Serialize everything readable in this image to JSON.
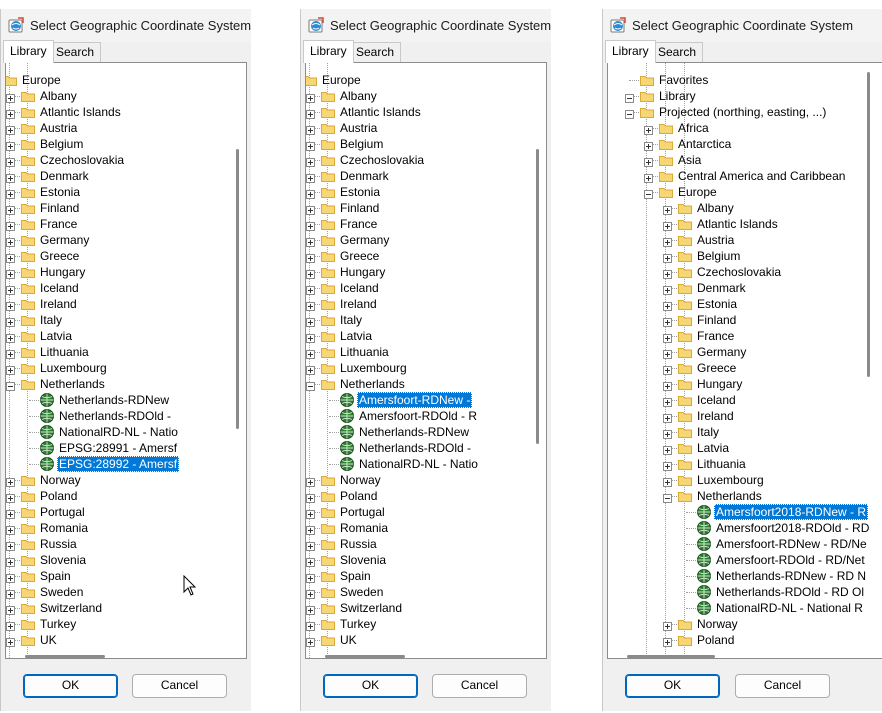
{
  "dialogs": [
    {
      "title": "Select Geographic Coordinate System",
      "tabs": [
        "Library",
        "Search"
      ],
      "ok_label": "OK",
      "cancel_label": "Cancel",
      "tree": [
        {
          "label": "Europe",
          "level": 1,
          "type": "folder",
          "expander": "minus"
        },
        {
          "label": "Albany",
          "level": 2,
          "type": "folder",
          "expander": "plus"
        },
        {
          "label": "Atlantic Islands",
          "level": 2,
          "type": "folder",
          "expander": "plus"
        },
        {
          "label": "Austria",
          "level": 2,
          "type": "folder",
          "expander": "plus"
        },
        {
          "label": "Belgium",
          "level": 2,
          "type": "folder",
          "expander": "plus"
        },
        {
          "label": "Czechoslovakia",
          "level": 2,
          "type": "folder",
          "expander": "plus"
        },
        {
          "label": "Denmark",
          "level": 2,
          "type": "folder",
          "expander": "plus"
        },
        {
          "label": "Estonia",
          "level": 2,
          "type": "folder",
          "expander": "plus"
        },
        {
          "label": "Finland",
          "level": 2,
          "type": "folder",
          "expander": "plus"
        },
        {
          "label": "France",
          "level": 2,
          "type": "folder",
          "expander": "plus"
        },
        {
          "label": "Germany",
          "level": 2,
          "type": "folder",
          "expander": "plus"
        },
        {
          "label": "Greece",
          "level": 2,
          "type": "folder",
          "expander": "plus"
        },
        {
          "label": "Hungary",
          "level": 2,
          "type": "folder",
          "expander": "plus"
        },
        {
          "label": "Iceland",
          "level": 2,
          "type": "folder",
          "expander": "plus"
        },
        {
          "label": "Ireland",
          "level": 2,
          "type": "folder",
          "expander": "plus"
        },
        {
          "label": "Italy",
          "level": 2,
          "type": "folder",
          "expander": "plus"
        },
        {
          "label": "Latvia",
          "level": 2,
          "type": "folder",
          "expander": "plus"
        },
        {
          "label": "Lithuania",
          "level": 2,
          "type": "folder",
          "expander": "plus"
        },
        {
          "label": "Luxembourg",
          "level": 2,
          "type": "folder",
          "expander": "plus"
        },
        {
          "label": "Netherlands",
          "level": 2,
          "type": "folder",
          "expander": "minus"
        },
        {
          "label": "Netherlands-RDNew",
          "level": 3,
          "type": "globe"
        },
        {
          "label": "Netherlands-RDOld -",
          "level": 3,
          "type": "globe"
        },
        {
          "label": "NationalRD-NL - Natio",
          "level": 3,
          "type": "globe"
        },
        {
          "label": "EPSG:28991 - Amersf",
          "level": 3,
          "type": "globe"
        },
        {
          "label": "EPSG:28992 - Amersf",
          "level": 3,
          "type": "globe",
          "selected": true
        },
        {
          "label": "Norway",
          "level": 2,
          "type": "folder",
          "expander": "plus"
        },
        {
          "label": "Poland",
          "level": 2,
          "type": "folder",
          "expander": "plus"
        },
        {
          "label": "Portugal",
          "level": 2,
          "type": "folder",
          "expander": "plus"
        },
        {
          "label": "Romania",
          "level": 2,
          "type": "folder",
          "expander": "plus"
        },
        {
          "label": "Russia",
          "level": 2,
          "type": "folder",
          "expander": "plus"
        },
        {
          "label": "Slovenia",
          "level": 2,
          "type": "folder",
          "expander": "plus"
        },
        {
          "label": "Spain",
          "level": 2,
          "type": "folder",
          "expander": "plus"
        },
        {
          "label": "Sweden",
          "level": 2,
          "type": "folder",
          "expander": "plus"
        },
        {
          "label": "Switzerland",
          "level": 2,
          "type": "folder",
          "expander": "plus"
        },
        {
          "label": "Turkey",
          "level": 2,
          "type": "folder",
          "expander": "plus"
        },
        {
          "label": "UK",
          "level": 2,
          "type": "folder",
          "expander": "plus"
        }
      ]
    },
    {
      "title": "Select Geographic Coordinate System",
      "tabs": [
        "Library",
        "Search"
      ],
      "ok_label": "OK",
      "cancel_label": "Cancel",
      "tree": [
        {
          "label": "Europe",
          "level": 1,
          "type": "folder",
          "expander": "minus"
        },
        {
          "label": "Albany",
          "level": 2,
          "type": "folder",
          "expander": "plus"
        },
        {
          "label": "Atlantic Islands",
          "level": 2,
          "type": "folder",
          "expander": "plus"
        },
        {
          "label": "Austria",
          "level": 2,
          "type": "folder",
          "expander": "plus"
        },
        {
          "label": "Belgium",
          "level": 2,
          "type": "folder",
          "expander": "plus"
        },
        {
          "label": "Czechoslovakia",
          "level": 2,
          "type": "folder",
          "expander": "plus"
        },
        {
          "label": "Denmark",
          "level": 2,
          "type": "folder",
          "expander": "plus"
        },
        {
          "label": "Estonia",
          "level": 2,
          "type": "folder",
          "expander": "plus"
        },
        {
          "label": "Finland",
          "level": 2,
          "type": "folder",
          "expander": "plus"
        },
        {
          "label": "France",
          "level": 2,
          "type": "folder",
          "expander": "plus"
        },
        {
          "label": "Germany",
          "level": 2,
          "type": "folder",
          "expander": "plus"
        },
        {
          "label": "Greece",
          "level": 2,
          "type": "folder",
          "expander": "plus"
        },
        {
          "label": "Hungary",
          "level": 2,
          "type": "folder",
          "expander": "plus"
        },
        {
          "label": "Iceland",
          "level": 2,
          "type": "folder",
          "expander": "plus"
        },
        {
          "label": "Ireland",
          "level": 2,
          "type": "folder",
          "expander": "plus"
        },
        {
          "label": "Italy",
          "level": 2,
          "type": "folder",
          "expander": "plus"
        },
        {
          "label": "Latvia",
          "level": 2,
          "type": "folder",
          "expander": "plus"
        },
        {
          "label": "Lithuania",
          "level": 2,
          "type": "folder",
          "expander": "plus"
        },
        {
          "label": "Luxembourg",
          "level": 2,
          "type": "folder",
          "expander": "plus"
        },
        {
          "label": "Netherlands",
          "level": 2,
          "type": "folder",
          "expander": "minus"
        },
        {
          "label": "Amersfoort-RDNew -",
          "level": 3,
          "type": "globe",
          "selected": true
        },
        {
          "label": "Amersfoort-RDOld - R",
          "level": 3,
          "type": "globe"
        },
        {
          "label": "Netherlands-RDNew",
          "level": 3,
          "type": "globe"
        },
        {
          "label": "Netherlands-RDOld -",
          "level": 3,
          "type": "globe"
        },
        {
          "label": "NationalRD-NL - Natio",
          "level": 3,
          "type": "globe"
        },
        {
          "label": "Norway",
          "level": 2,
          "type": "folder",
          "expander": "plus"
        },
        {
          "label": "Poland",
          "level": 2,
          "type": "folder",
          "expander": "plus"
        },
        {
          "label": "Portugal",
          "level": 2,
          "type": "folder",
          "expander": "plus"
        },
        {
          "label": "Romania",
          "level": 2,
          "type": "folder",
          "expander": "plus"
        },
        {
          "label": "Russia",
          "level": 2,
          "type": "folder",
          "expander": "plus"
        },
        {
          "label": "Slovenia",
          "level": 2,
          "type": "folder",
          "expander": "plus"
        },
        {
          "label": "Spain",
          "level": 2,
          "type": "folder",
          "expander": "plus"
        },
        {
          "label": "Sweden",
          "level": 2,
          "type": "folder",
          "expander": "plus"
        },
        {
          "label": "Switzerland",
          "level": 2,
          "type": "folder",
          "expander": "plus"
        },
        {
          "label": "Turkey",
          "level": 2,
          "type": "folder",
          "expander": "plus"
        },
        {
          "label": "UK",
          "level": 2,
          "type": "folder",
          "expander": "plus"
        }
      ]
    },
    {
      "title": "Select Geographic Coordinate System",
      "tabs": [
        "Library",
        "Search"
      ],
      "ok_label": "OK",
      "cancel_label": "Cancel",
      "tree": [
        {
          "label": "Favorites",
          "level": 0,
          "type": "folder"
        },
        {
          "label": "Library",
          "level": 0,
          "type": "folder",
          "expander": "minus"
        },
        {
          "label": "Projected (northing, easting, ...)",
          "level": 1,
          "type": "folder",
          "expander": "minus"
        },
        {
          "label": "Africa",
          "level": 2,
          "type": "folder",
          "expander": "plus"
        },
        {
          "label": "Antarctica",
          "level": 2,
          "type": "folder",
          "expander": "plus"
        },
        {
          "label": "Asia",
          "level": 2,
          "type": "folder",
          "expander": "plus"
        },
        {
          "label": "Central America and Caribbean",
          "level": 2,
          "type": "folder",
          "expander": "plus"
        },
        {
          "label": "Europe",
          "level": 2,
          "type": "folder",
          "expander": "minus"
        },
        {
          "label": "Albany",
          "level": 3,
          "type": "folder",
          "expander": "plus"
        },
        {
          "label": "Atlantic Islands",
          "level": 3,
          "type": "folder",
          "expander": "plus"
        },
        {
          "label": "Austria",
          "level": 3,
          "type": "folder",
          "expander": "plus"
        },
        {
          "label": "Belgium",
          "level": 3,
          "type": "folder",
          "expander": "plus"
        },
        {
          "label": "Czechoslovakia",
          "level": 3,
          "type": "folder",
          "expander": "plus"
        },
        {
          "label": "Denmark",
          "level": 3,
          "type": "folder",
          "expander": "plus"
        },
        {
          "label": "Estonia",
          "level": 3,
          "type": "folder",
          "expander": "plus"
        },
        {
          "label": "Finland",
          "level": 3,
          "type": "folder",
          "expander": "plus"
        },
        {
          "label": "France",
          "level": 3,
          "type": "folder",
          "expander": "plus"
        },
        {
          "label": "Germany",
          "level": 3,
          "type": "folder",
          "expander": "plus"
        },
        {
          "label": "Greece",
          "level": 3,
          "type": "folder",
          "expander": "plus"
        },
        {
          "label": "Hungary",
          "level": 3,
          "type": "folder",
          "expander": "plus"
        },
        {
          "label": "Iceland",
          "level": 3,
          "type": "folder",
          "expander": "plus"
        },
        {
          "label": "Ireland",
          "level": 3,
          "type": "folder",
          "expander": "plus"
        },
        {
          "label": "Italy",
          "level": 3,
          "type": "folder",
          "expander": "plus"
        },
        {
          "label": "Latvia",
          "level": 3,
          "type": "folder",
          "expander": "plus"
        },
        {
          "label": "Lithuania",
          "level": 3,
          "type": "folder",
          "expander": "plus"
        },
        {
          "label": "Luxembourg",
          "level": 3,
          "type": "folder",
          "expander": "plus"
        },
        {
          "label": "Netherlands",
          "level": 3,
          "type": "folder",
          "expander": "minus"
        },
        {
          "label": "Amersfoort2018-RDNew - R",
          "level": 4,
          "type": "globe",
          "selected": true
        },
        {
          "label": "Amersfoort2018-RDOld - RD",
          "level": 4,
          "type": "globe"
        },
        {
          "label": "Amersfoort-RDNew - RD/Ne",
          "level": 4,
          "type": "globe"
        },
        {
          "label": "Amersfoort-RDOld - RD/Net",
          "level": 4,
          "type": "globe"
        },
        {
          "label": "Netherlands-RDNew - RD N",
          "level": 4,
          "type": "globe"
        },
        {
          "label": "Netherlands-RDOld - RD Ol",
          "level": 4,
          "type": "globe"
        },
        {
          "label": "NationalRD-NL - National R",
          "level": 4,
          "type": "globe"
        },
        {
          "label": "Norway",
          "level": 3,
          "type": "folder",
          "expander": "plus"
        },
        {
          "label": "Poland",
          "level": 3,
          "type": "folder",
          "expander": "plus"
        }
      ]
    }
  ],
  "colors": {
    "selection": "#0078d7",
    "folder": "#f7d774",
    "folder_edge": "#d9a93a",
    "globe": "#2e7d32",
    "button_focus": "#0067c0"
  }
}
